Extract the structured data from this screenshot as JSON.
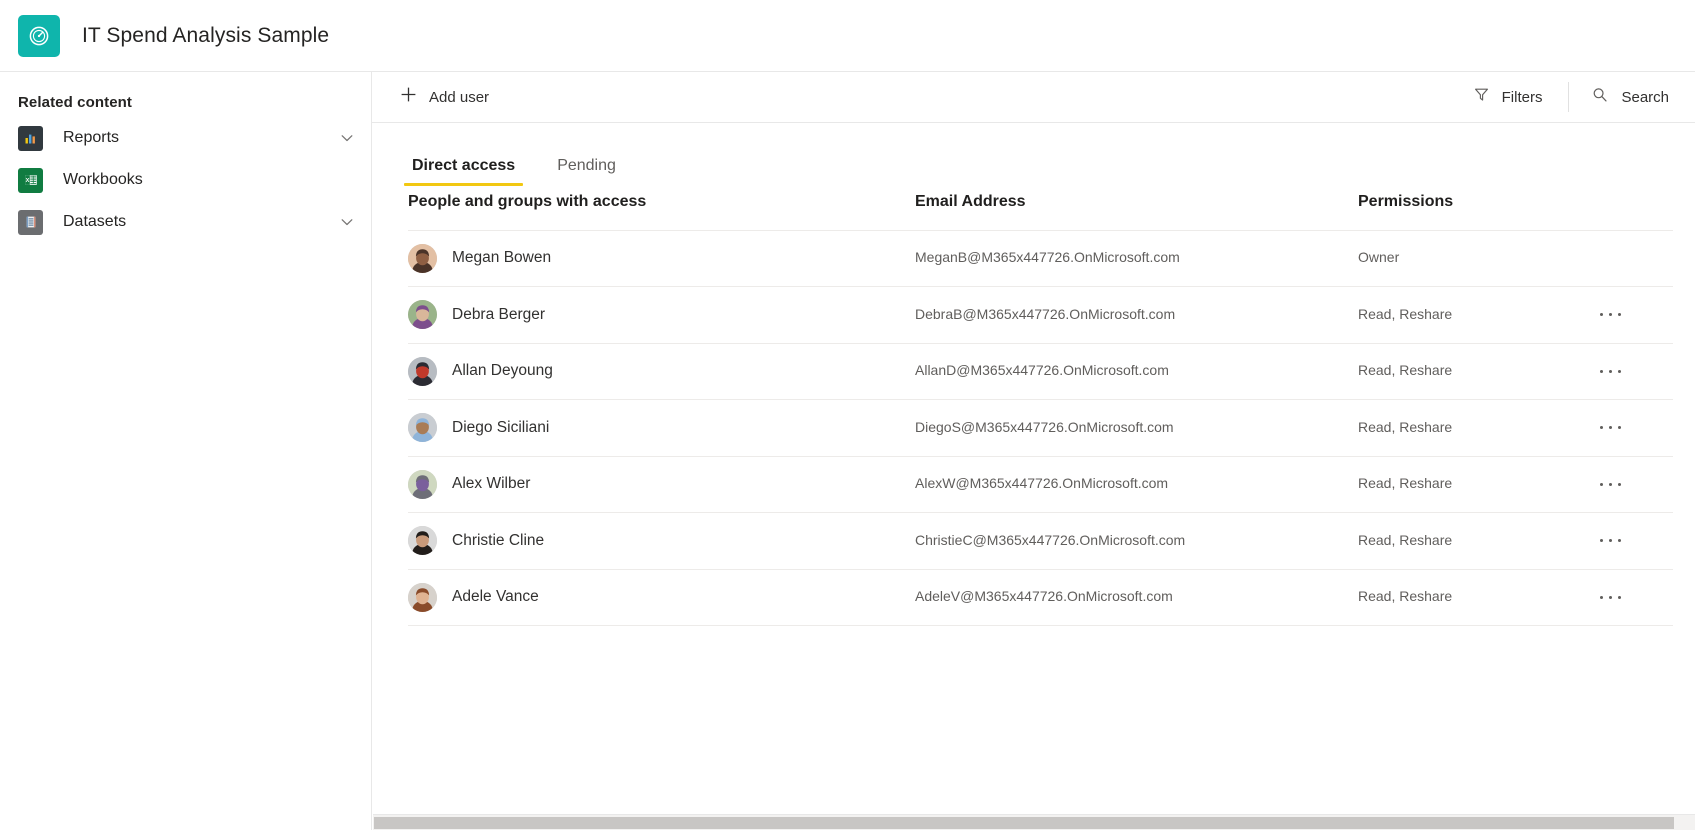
{
  "header": {
    "title": "IT Spend Analysis Sample",
    "icon": "gauge-icon",
    "icon_color": "#0fb5ac"
  },
  "sidebar": {
    "title": "Related content",
    "items": [
      {
        "label": "Reports",
        "icon": "report-chart-icon",
        "icon_color": "#31393f",
        "has_chevron": true
      },
      {
        "label": "Workbooks",
        "icon": "excel-workbook-icon",
        "icon_color": "#107c41",
        "has_chevron": false
      },
      {
        "label": "Datasets",
        "icon": "dataset-database-icon",
        "icon_color": "#6b6d70",
        "has_chevron": true
      }
    ]
  },
  "toolbar": {
    "add_user_label": "Add user",
    "add_user_icon": "plus-icon",
    "filters_label": "Filters",
    "filters_icon": "funnel-icon",
    "search_label": "Search",
    "search_icon": "search-icon"
  },
  "tabs": [
    {
      "label": "Direct access",
      "active": true
    },
    {
      "label": "Pending",
      "active": false
    }
  ],
  "tab_accent_color": "#f2c811",
  "table": {
    "columns": [
      "People and groups with access",
      "Email Address",
      "Permissions"
    ],
    "rows": [
      {
        "name": "Megan Bowen",
        "email": "MeganB@M365x447726.OnMicrosoft.com",
        "permission": "Owner",
        "has_menu": false,
        "avatar_colors": [
          "#e3c0a4",
          "#4a3328",
          "#8f5f43"
        ]
      },
      {
        "name": "Debra Berger",
        "email": "DebraB@M365x447726.OnMicrosoft.com",
        "permission": "Read, Reshare",
        "has_menu": true,
        "avatar_colors": [
          "#9ab48a",
          "#7d4f8c",
          "#d9b79a"
        ]
      },
      {
        "name": "Allan Deyoung",
        "email": "AllanD@M365x447726.OnMicrosoft.com",
        "permission": "Read, Reshare",
        "has_menu": true,
        "avatar_colors": [
          "#b7bcc2",
          "#2b2b33",
          "#c0392b"
        ]
      },
      {
        "name": "Diego Siciliani",
        "email": "DiegoS@M365x447726.OnMicrosoft.com",
        "permission": "Read, Reshare",
        "has_menu": true,
        "avatar_colors": [
          "#c9cdd2",
          "#8fb4d9",
          "#a97c56"
        ]
      },
      {
        "name": "Alex Wilber",
        "email": "AlexW@M365x447726.OnMicrosoft.com",
        "permission": "Read, Reshare",
        "has_menu": true,
        "avatar_colors": [
          "#cfd8c0",
          "#6e6e78",
          "#7a5f9c"
        ]
      },
      {
        "name": "Christie Cline",
        "email": "ChristieC@M365x447726.OnMicrosoft.com",
        "permission": "Read, Reshare",
        "has_menu": true,
        "avatar_colors": [
          "#d9d9d9",
          "#221d1a",
          "#c99a7a"
        ]
      },
      {
        "name": "Adele Vance",
        "email": "AdeleV@M365x447726.OnMicrosoft.com",
        "permission": "Read, Reshare",
        "has_menu": true,
        "avatar_colors": [
          "#d7d2cc",
          "#8a4b2a",
          "#e0b392"
        ]
      }
    ]
  },
  "scrollbar": {
    "orientation": "horizontal"
  }
}
